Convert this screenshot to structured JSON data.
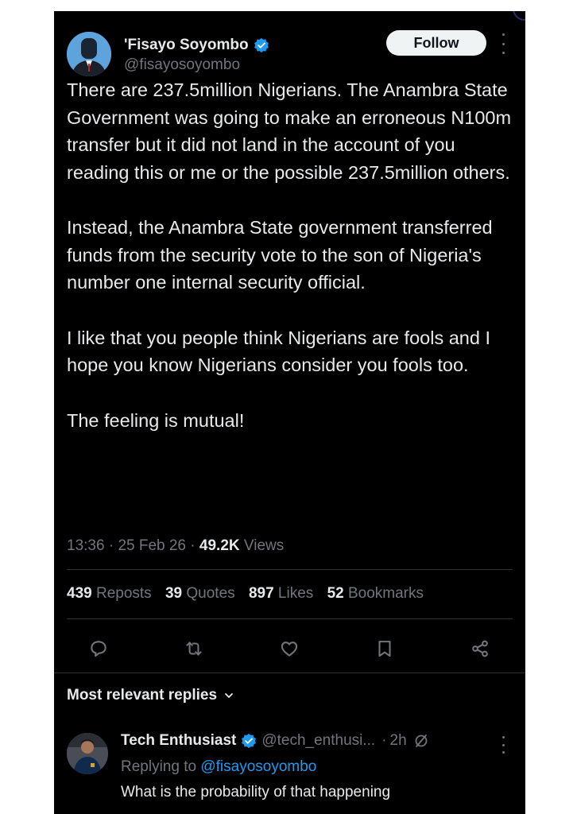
{
  "author": {
    "name": "'Fisayo Soyombo",
    "handle": "@fisayosoyombo",
    "follow_label": "Follow"
  },
  "tweet": {
    "paragraphs": [
      "There are 237.5million Nigerians. The Anambra State Government was going to make an erroneous N100m transfer but it did not land in the account of you reading this or me or the possible 237.5million others.",
      "Instead, the Anambra State government transferred funds from the security vote to the son of Nigeria's number one internal security official.",
      "I like that you people think Nigerians are fools and I hope you know Nigerians consider you fools too.",
      "The feeling is mutual!"
    ],
    "time": "13:36",
    "date": "25 Feb 26",
    "views_count": "49.2K",
    "views_label": "Views"
  },
  "stats": {
    "reposts_count": "439",
    "reposts_label": "Reposts",
    "quotes_count": "39",
    "quotes_label": "Quotes",
    "likes_count": "897",
    "likes_label": "Likes",
    "bookmarks_count": "52",
    "bookmarks_label": "Bookmarks"
  },
  "actions": [
    "reply-icon",
    "repost-icon",
    "like-icon",
    "bookmark-icon",
    "share-icon"
  ],
  "replies_section": {
    "title": "Most relevant replies"
  },
  "reply": {
    "name": "Tech Enthusiast",
    "handle": "@tech_enthusi...",
    "time": "2h",
    "replying_prefix": "Replying to",
    "replying_handle": "@fisayosoyombo",
    "text": "What is the probability of that happening"
  },
  "colors": {
    "background": "#000000",
    "text": "#e7e9ea",
    "secondary": "#71767b",
    "accent": "#1d9bf0",
    "divider": "#2f3336"
  }
}
